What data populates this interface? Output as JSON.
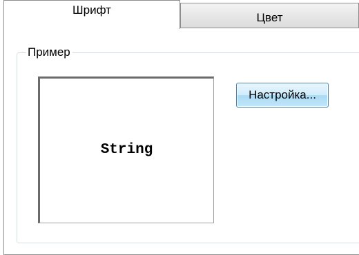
{
  "tabs": [
    {
      "label": "Шрифт",
      "active": true
    },
    {
      "label": "Цвет",
      "active": false
    }
  ],
  "group": {
    "title": "Пример"
  },
  "preview": {
    "text": "String"
  },
  "buttons": {
    "settings": "Настройка..."
  }
}
